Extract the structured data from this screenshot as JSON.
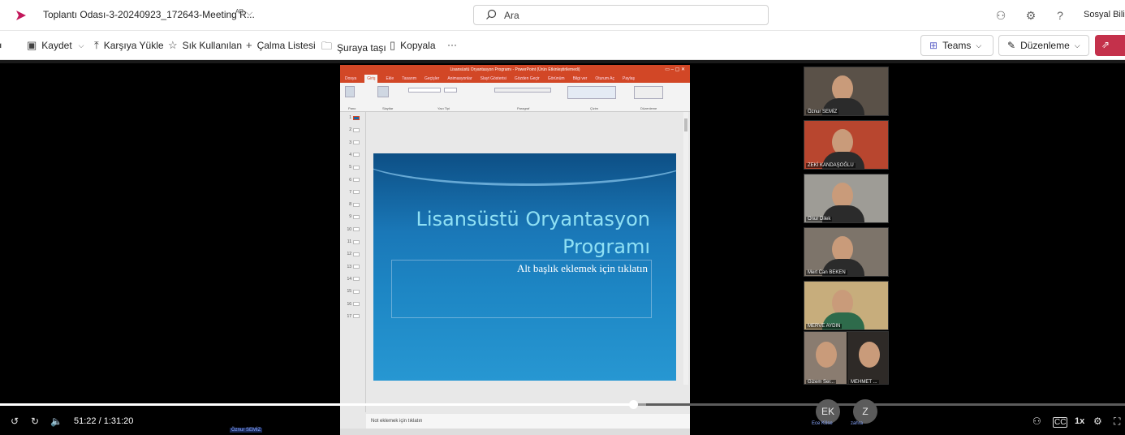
{
  "window": {
    "doc_title": "Toplantı Odası-3-20240923_172643-Meeting R...",
    "search_placeholder": "Ara",
    "user_name": "Sosyal Bilim"
  },
  "toolbar": {
    "save": "Kaydet",
    "upload": "Karşıya Yükle",
    "favorites": "Sık Kullanılan",
    "playlist": "Çalma Listesi",
    "move": "Şuraya taşı",
    "copy": "Kopyala",
    "more": "···",
    "teams": "Teams",
    "edit": "Düzenleme"
  },
  "ppt": {
    "window_title": "Lisansüstü Oryantasyon Programı - PowerPoint (Ürün Etkinleştirilemedi)",
    "tabs": [
      "Dosya",
      "Giriş",
      "Ekle",
      "Tasarım",
      "Geçişler",
      "Animasyonlar",
      "Slayt Gösterisi",
      "Gözden Geçir",
      "Görünüm",
      "Bilgi ver",
      "Oturum Aç",
      "Paylaş"
    ],
    "groups": [
      "Pano",
      "Slaytlar",
      "Yazı Tipi",
      "Paragraf",
      "Çizim",
      "Düzenleme"
    ],
    "thumb_numbers": [
      "1",
      "2",
      "3",
      "4",
      "5",
      "6",
      "7",
      "8",
      "9",
      "10",
      "11",
      "12",
      "13",
      "14",
      "15",
      "16",
      "17"
    ],
    "slide_title_line1": "Lisansüstü Oryantasyon",
    "slide_title_line2": "Programı",
    "slide_subtitle": "Alt başlık eklemek için tıklatın",
    "notes_placeholder": "Not eklemek için tıklatın"
  },
  "participants": [
    {
      "name": "Öznur SEMİZ",
      "bg": "#5a5148"
    },
    {
      "name": "ZEKİ KANDAŞOĞLU",
      "bg": "#b8462f"
    },
    {
      "name": "Onur Dilek",
      "bg": "#9e9c96"
    },
    {
      "name": "Mert Can BEKEN",
      "bg": "#7d746a"
    },
    {
      "name": "MERVE AYDIN",
      "bg": "#c7ad7c"
    },
    {
      "name": "Gizem Ser...",
      "bg": "#8a7c70"
    },
    {
      "name": "MEHMET ...",
      "bg": "#2e2a27"
    }
  ],
  "player": {
    "time": "51:22 / 1:31:20",
    "progress_fraction": 0.5625,
    "speed": "1x",
    "avatars": [
      {
        "initials": "EK",
        "label": "Ece Köse"
      },
      {
        "initials": "Z",
        "label": "zahra"
      }
    ],
    "active_speaker_tag": "Öznur SEMİZ"
  },
  "colors": {
    "accent_share": "#c4314b",
    "ppt_orange": "#d24726",
    "slide_title": "#8fe0f4"
  }
}
